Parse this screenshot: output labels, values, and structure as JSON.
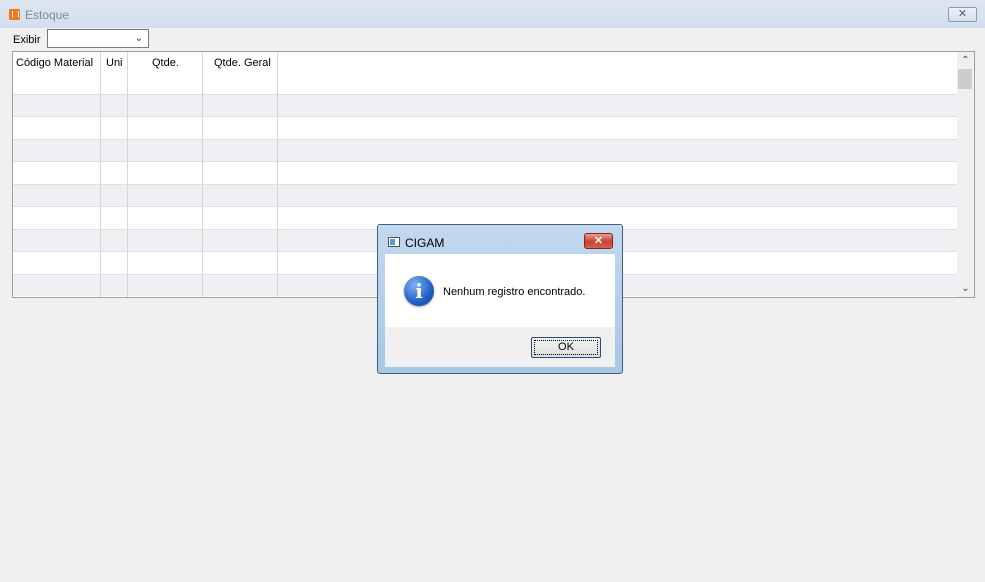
{
  "window": {
    "title": "Estoque",
    "close_glyph": "✕"
  },
  "filter": {
    "label": "Exibir",
    "value": ""
  },
  "grid": {
    "columns": [
      "Código Material",
      "Uni",
      "Qtde.",
      "Qtde. Geral"
    ],
    "rows": []
  },
  "dialog": {
    "title": "CIGAM",
    "close_glyph": "✕",
    "icon": "info-icon",
    "message": "Nenhum registro encontrado.",
    "ok_label": "OK"
  },
  "colors": {
    "titlebar": "#d3dfee",
    "row_alt": "#eff0f4",
    "dialog_frame": "#a9c6e6",
    "close_red": "#c9412c"
  }
}
